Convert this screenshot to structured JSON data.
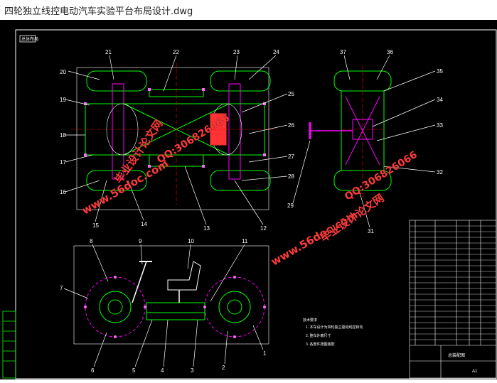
{
  "window": {
    "title": "四轮独立线控电动汽车实验平台布局设计.dwg"
  },
  "drawing": {
    "corner_tag": "总体布局",
    "top_view_labels": [
      "12",
      "13",
      "14",
      "15",
      "16",
      "17",
      "18",
      "19",
      "20",
      "21",
      "22",
      "23",
      "24",
      "25",
      "26",
      "27",
      "28"
    ],
    "side_view_labels": [
      "29",
      "31",
      "32",
      "33",
      "34",
      "35",
      "36",
      "37"
    ],
    "elevation_labels": [
      "1",
      "2",
      "3",
      "4",
      "5",
      "6",
      "7",
      "8",
      "9",
      "10",
      "11"
    ],
    "notes_title": "技术要求",
    "notes": [
      "1. 本车设计为四轮独立驱动线控转向",
      "2. 整车外廓尺寸",
      "3. 各部件按图装配"
    ],
    "title_block": {
      "name": "总装配图",
      "code": "A1"
    }
  },
  "watermarks": {
    "site": "www.56doc.com",
    "brand": "毕业设计论文网",
    "qq": "QQ:306826066"
  },
  "colors": {
    "frame": "#ffffff",
    "line": "#00ff00",
    "leader": "#ffffff",
    "accent": "#ff00ff",
    "watermark": "#ff3b3b"
  }
}
